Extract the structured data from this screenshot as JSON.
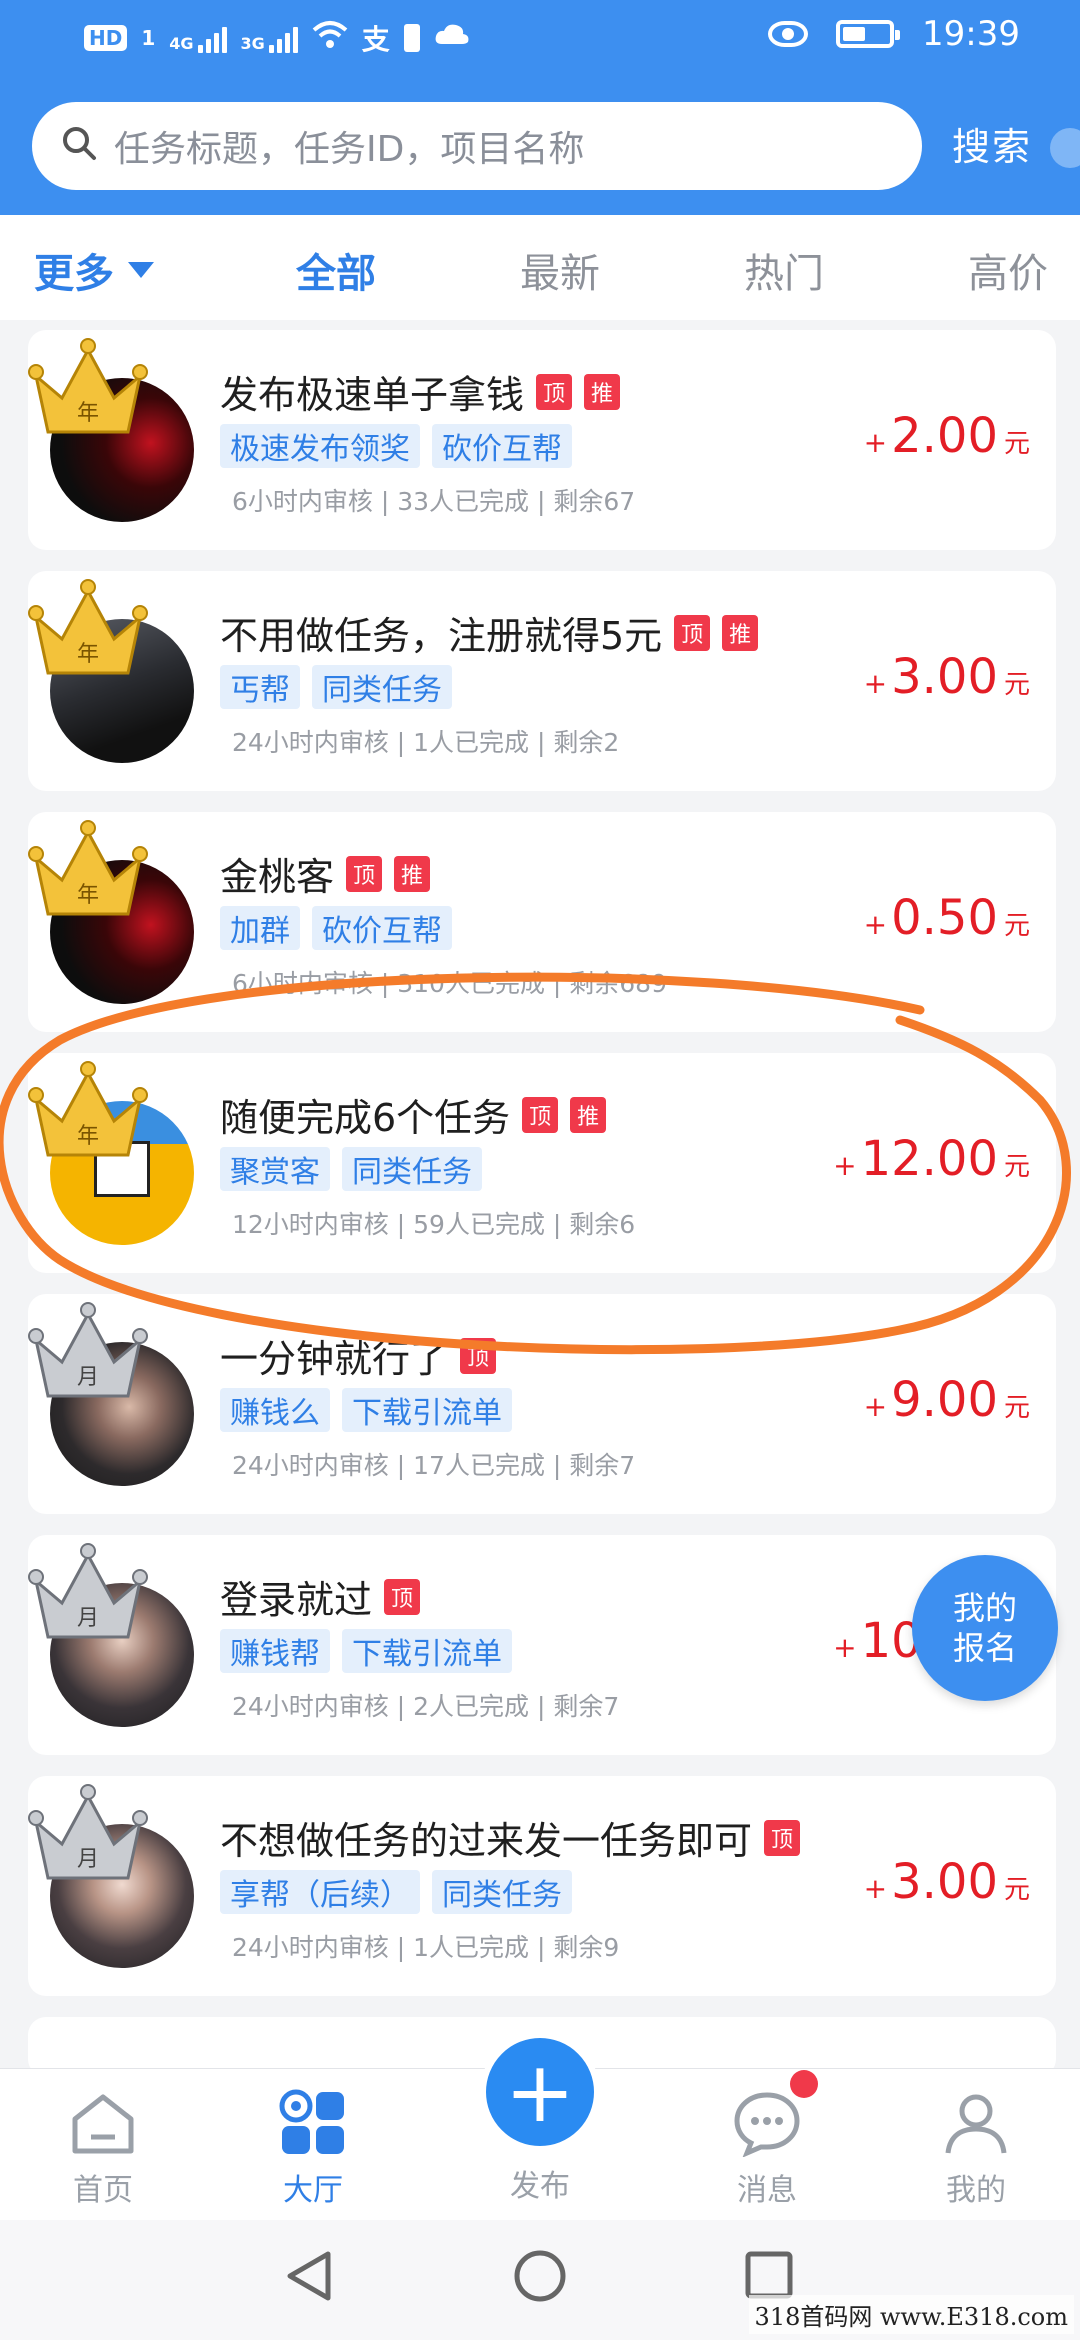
{
  "status_bar": {
    "hd": "HD",
    "sim": "1",
    "net1": "4G",
    "net2": "3G",
    "time": "19:39"
  },
  "search": {
    "placeholder": "任务标题，任务ID，项目名称",
    "button": "搜索"
  },
  "tabs": [
    {
      "label": "更多",
      "active": false
    },
    {
      "label": "全部",
      "active": true
    },
    {
      "label": "最新",
      "active": false
    },
    {
      "label": "热门",
      "active": false
    },
    {
      "label": "高价",
      "active": false
    }
  ],
  "tasks": [
    {
      "crown": "gold",
      "crown_char": "年",
      "title": "发布极速单子拿钱",
      "badges": [
        "顶",
        "推"
      ],
      "tags": [
        "极速发布领奖",
        "砍价互帮"
      ],
      "review": "6小时内审核",
      "completed": "33人已完成",
      "remaining": "剩余67",
      "price": "2.00",
      "plus": "+",
      "unit": "元"
    },
    {
      "crown": "gold",
      "crown_char": "年",
      "title": "不用做任务，注册就得5元",
      "badges": [
        "顶",
        "推"
      ],
      "tags": [
        "丐帮",
        "同类任务"
      ],
      "review": "24小时内审核",
      "completed": "1人已完成",
      "remaining": "剩余2",
      "price": "3.00",
      "plus": "+",
      "unit": "元"
    },
    {
      "crown": "gold",
      "crown_char": "年",
      "title": "金桃客",
      "badges": [
        "顶",
        "推"
      ],
      "tags": [
        "加群",
        "砍价互帮"
      ],
      "review": "6小时内审核",
      "completed": "310人已完成",
      "remaining": "剩余689",
      "price": "0.50",
      "plus": "+",
      "unit": "元"
    },
    {
      "crown": "gold",
      "crown_char": "年",
      "title": "随便完成6个任务",
      "badges": [
        "顶",
        "推"
      ],
      "tags": [
        "聚赏客",
        "同类任务"
      ],
      "review": "12小时内审核",
      "completed": "59人已完成",
      "remaining": "剩余6",
      "price": "12.00",
      "plus": "+",
      "unit": "元"
    },
    {
      "crown": "silver",
      "crown_char": "月",
      "title": "一分钟就行了",
      "badges": [
        "顶"
      ],
      "tags": [
        "赚钱么",
        "下载引流单"
      ],
      "review": "24小时内审核",
      "completed": "17人已完成",
      "remaining": "剩余7",
      "price": "9.00",
      "plus": "+",
      "unit": "元"
    },
    {
      "crown": "silver",
      "crown_char": "月",
      "title": "登录就过",
      "badges": [
        "顶"
      ],
      "tags": [
        "赚钱帮",
        "下载引流单"
      ],
      "review": "24小时内审核",
      "completed": "2人已完成",
      "remaining": "剩余7",
      "price": "10.00",
      "plus": "+",
      "unit": "元"
    },
    {
      "crown": "silver",
      "crown_char": "月",
      "title": "不想做任务的过来发一任务即可",
      "badges": [
        "顶"
      ],
      "tags": [
        "享帮（后续）",
        "同类任务"
      ],
      "review": "24小时内审核",
      "completed": "1人已完成",
      "remaining": "剩余9",
      "price": "3.00",
      "plus": "+",
      "unit": "元"
    }
  ],
  "fab": {
    "line1": "我的",
    "line2": "报名"
  },
  "bottom_nav": {
    "home": "首页",
    "hall": "大厅",
    "publish": "发布",
    "messages": "消息",
    "mine": "我的"
  },
  "watermark": "318首码网  www.E318.com",
  "colors": {
    "primary": "#3d8ff0",
    "price": "#e31e26",
    "badge": "#f0394a",
    "tag_bg": "#e4effc",
    "highlight": "#f47b2a"
  }
}
